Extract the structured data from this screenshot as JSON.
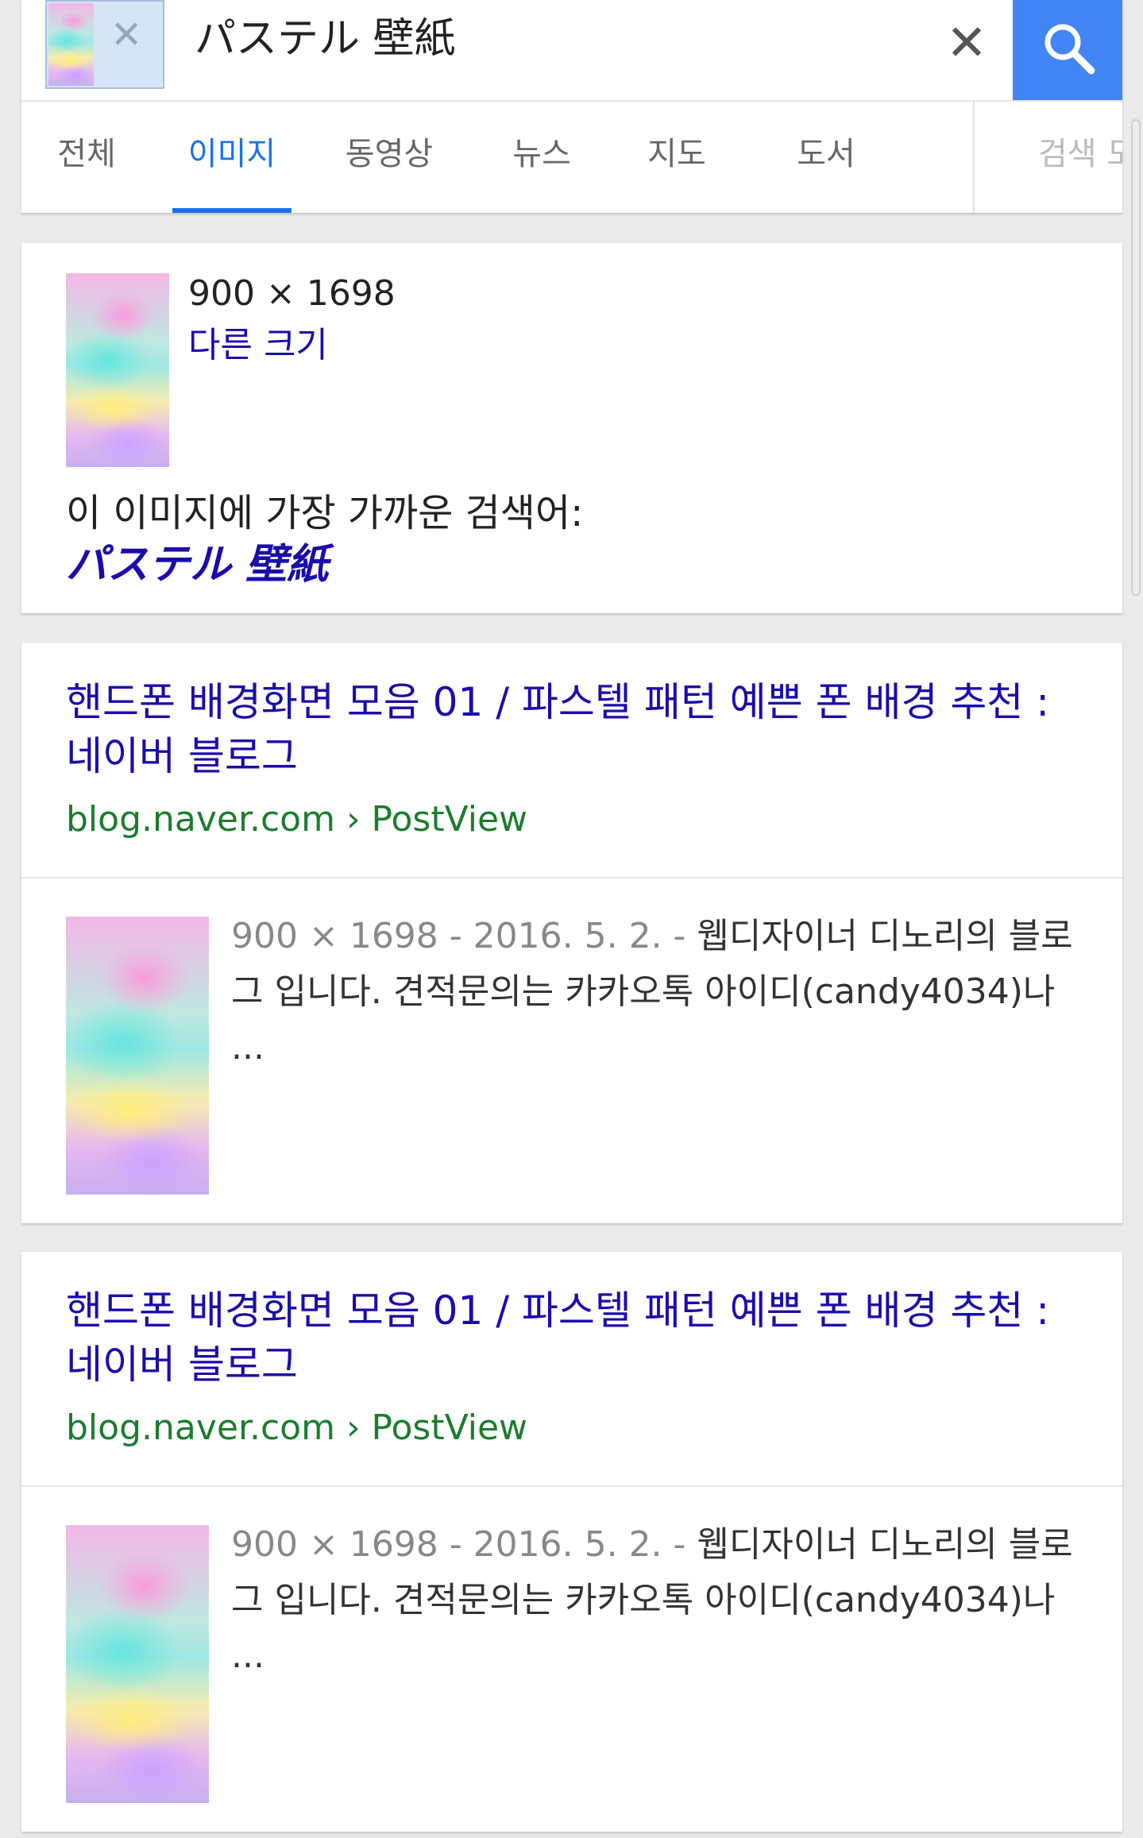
{
  "search": {
    "query": "パステル 壁紙",
    "clear_glyph": "✕",
    "search_icon": "search-icon",
    "accent": "#4285f4"
  },
  "tabs": [
    {
      "label": "전체"
    },
    {
      "label": "이미지",
      "active": true
    },
    {
      "label": "동영상"
    },
    {
      "label": "뉴스"
    },
    {
      "label": "지도"
    },
    {
      "label": "도서"
    },
    {
      "label": "검색 도"
    }
  ],
  "info": {
    "size": "900 × 1698",
    "other_sizes": "다른 크기",
    "related_label": "이 이미지에 가장 가까운 검색어:",
    "related_term": "パステル 壁紙"
  },
  "results": [
    {
      "title": "핸드폰 배경화면 모음 01 / 파스텔 패턴 예쁜 폰 배경 추천 : 네이버 블로그",
      "url": "blog.naver.com › PostView",
      "meta": "900 × 1698 - 2016. 5. 2. - ",
      "snippet": "웹디자이너 디노리의 블로그 입니다. 견적문의는 카카오톡 아이디(candy4034)나 ..."
    },
    {
      "title": "핸드폰 배경화면 모음 01 / 파스텔 패턴 예쁜 폰 배경 추천 : 네이버 블로그",
      "url": "blog.naver.com › PostView",
      "meta": "900 × 1698 - 2016. 5. 2. - ",
      "snippet": "웹디자이너 디노리의 블로그 입니다. 견적문의는 카카오톡 아이디(candy4034)나 ..."
    }
  ],
  "colors": {
    "link": "#1a0dab",
    "url": "#1b7d2c",
    "tab_active": "#1a73e8"
  }
}
